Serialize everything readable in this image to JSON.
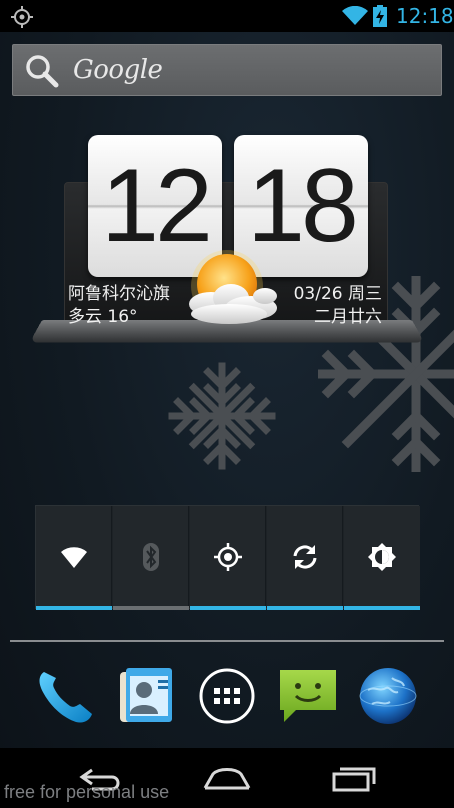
{
  "status_bar": {
    "time": "12:18",
    "icons": [
      "gps-icon",
      "wifi-icon",
      "battery-charging-icon"
    ],
    "accent_color": "#33b5e5"
  },
  "search": {
    "label": "Google",
    "icon": "search-icon"
  },
  "clock_widget": {
    "hours": "12",
    "minutes": "18",
    "city": "阿鲁科尔沁旗",
    "weather": "多云 16°",
    "date": "03/26 周三",
    "lunar_date": "二月廿六",
    "weather_icon": "partly-cloudy-icon"
  },
  "quick_settings": {
    "tiles": [
      {
        "name": "wifi",
        "icon": "wifi-icon",
        "enabled": true
      },
      {
        "name": "bluetooth",
        "icon": "bluetooth-icon",
        "enabled": false
      },
      {
        "name": "gps",
        "icon": "gps-icon",
        "enabled": true
      },
      {
        "name": "sync",
        "icon": "sync-icon",
        "enabled": true
      },
      {
        "name": "brightness",
        "icon": "brightness-icon",
        "enabled": true
      }
    ],
    "on_color": "#33b5e5",
    "off_color": "#6b6f72"
  },
  "dock": {
    "apps": [
      "phone-icon",
      "contacts-icon",
      "app-drawer-icon",
      "messaging-icon",
      "browser-icon"
    ]
  },
  "nav_bar": {
    "buttons": [
      "back-icon",
      "home-icon",
      "recent-apps-icon"
    ]
  },
  "watermark": "free for personal use"
}
